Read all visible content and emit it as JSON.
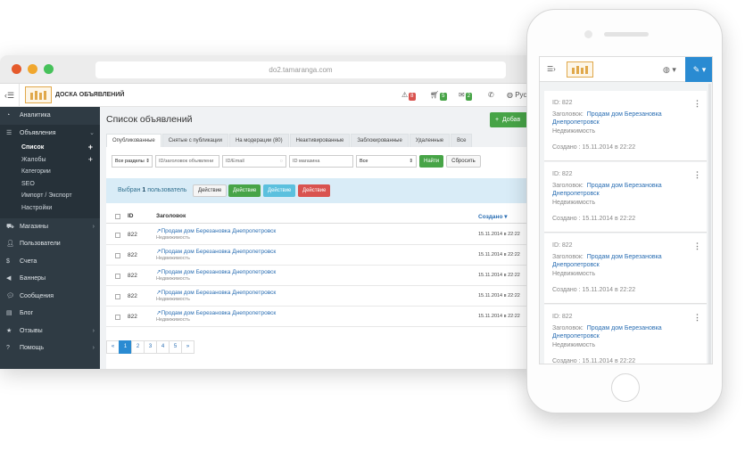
{
  "browser": {
    "url": "do2.tamaranga.com"
  },
  "topbar": {
    "site_title": "ДОСКА ОБЪЯВЛЕНИЙ",
    "alerts_count": "8",
    "cart_count": "5",
    "mail_count": "2",
    "lang_label": "Русс"
  },
  "sidebar": {
    "items": [
      {
        "label": "Аналитика",
        "icon": "dashboard-icon"
      },
      {
        "label": "Объявления",
        "icon": "list-icon"
      },
      {
        "label": "Магазины",
        "icon": "cart-icon"
      },
      {
        "label": "Пользователи",
        "icon": "user-icon"
      },
      {
        "label": "Счета",
        "icon": "dollar-icon"
      },
      {
        "label": "Баннеры",
        "icon": "bullhorn-icon"
      },
      {
        "label": "Сообщения",
        "icon": "comment-icon"
      },
      {
        "label": "Блог",
        "icon": "book-icon"
      },
      {
        "label": "Отзывы",
        "icon": "star-icon"
      },
      {
        "label": "Помощь",
        "icon": "help-icon"
      }
    ],
    "subitems": [
      "Список",
      "Жалобы",
      "Категории",
      "SEO",
      "Импорт / Экспорт",
      "Настройки"
    ]
  },
  "main": {
    "title": "Список объявлений",
    "add_label": "Добав",
    "tabs": [
      "Опубликованные",
      "Снятые с публикации",
      "На модерации (80)",
      "Неактивированные",
      "Заблокированные",
      "Удаленные",
      "Все"
    ],
    "filters": {
      "sections": "Все разделы",
      "title_placeholder": "ID/заголовок объявлени",
      "email_placeholder": "ID/Email",
      "shop_placeholder": "ID магазина",
      "status": "Все",
      "find": "Найти",
      "reset": "Сбросить"
    },
    "selection": {
      "prefix": "Выбран",
      "count": "1",
      "suffix": "пользователь",
      "actions": [
        "Действие",
        "Действие",
        "Действие",
        "Действие"
      ]
    },
    "table": {
      "col_id": "ID",
      "col_title": "Заголовок",
      "col_created": "Создано ▾",
      "rows": [
        {
          "id": "822",
          "title": "Продам дом Березановка Днепропетровск",
          "category": "Недвижимость",
          "date": "15.11.2014 в 22:22"
        },
        {
          "id": "822",
          "title": "Продам дом Березановка Днепропетровск",
          "category": "Недвижимость",
          "date": "15.11.2014 в 22:22"
        },
        {
          "id": "822",
          "title": "Продам дом Березановка Днепропетровск",
          "category": "Недвижимость",
          "date": "15.11.2014 в 22:22"
        },
        {
          "id": "822",
          "title": "Продам дом Березановка Днепропетровск",
          "category": "Недвижимость",
          "date": "15.11.2014 в 22:22"
        },
        {
          "id": "822",
          "title": "Продам дом Березановка Днепропетровск",
          "category": "Недвижимость",
          "date": "15.11.2014 в 22:22"
        }
      ]
    },
    "pagination": [
      "«",
      "1",
      "2",
      "3",
      "4",
      "5",
      "»"
    ]
  },
  "phone": {
    "cards": [
      {
        "id_label": "ID: 822",
        "title_prefix": "Заголовок:",
        "title_1": "Продам дом Березановка",
        "title_2": "Днепропетровск",
        "category": "Недвижимость",
        "created": "Создано : 15.11.2014 в 22:22"
      },
      {
        "id_label": "ID: 822",
        "title_prefix": "Заголовок:",
        "title_1": "Продам дом Березановка",
        "title_2": "Днепропетровск",
        "category": "Недвижимость",
        "created": "Создано : 15.11.2014 в 22:22"
      },
      {
        "id_label": "ID: 822",
        "title_prefix": "Заголовок:",
        "title_1": "Продам дом Березановка",
        "title_2": "Днепропетровск",
        "category": "Недвижимость",
        "created": "Создано : 15.11.2014 в 22:22"
      },
      {
        "id_label": "ID: 822",
        "title_prefix": "Заголовок:",
        "title_1": "Продам дом Березановка",
        "title_2": "Днепропетровск",
        "category": "Недвижимость",
        "created": "Создано : 15.11.2014 в 22:22"
      }
    ]
  },
  "colors": {
    "sidebar_bg": "#2f3b44",
    "accent_blue": "#2a8bd2",
    "success_green": "#47a447",
    "danger_red": "#d9534f",
    "info_blue": "#5bc0de"
  }
}
